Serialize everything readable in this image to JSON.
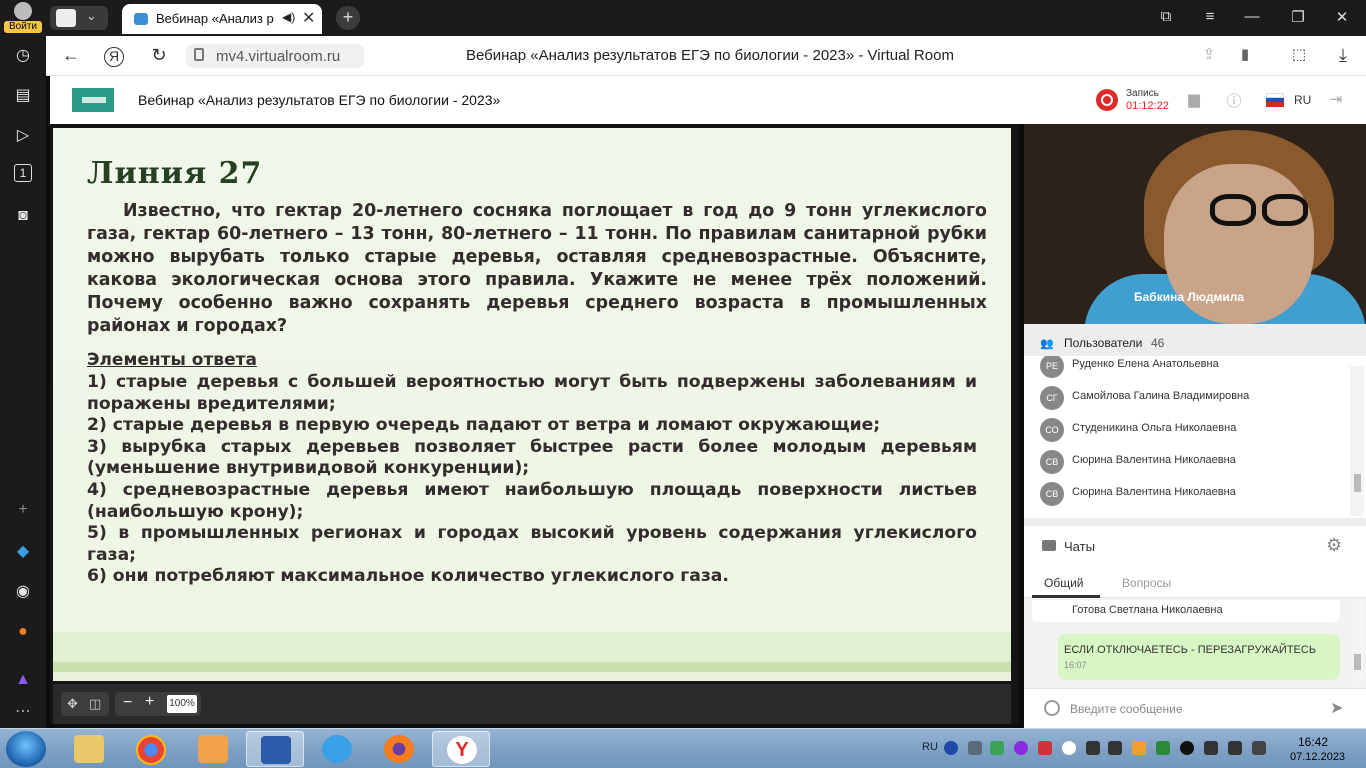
{
  "browser": {
    "login_label": "Войти",
    "tab_title": "Вебинар «Анализ ре",
    "url": "mv4.virtualroom.ru",
    "page_title": "Вебинар «Анализ результатов ЕГЭ по биологии - 2023» - Virtual Room"
  },
  "app": {
    "webinar_title": "Вебинар «Анализ результатов ЕГЭ по биологии - 2023»",
    "record_label": "Запись",
    "record_time": "01:12:22",
    "language": "RU"
  },
  "slide": {
    "heading": "Линия 27",
    "question": "Известно, что гектар 20-летнего сосняка поглощает в год до 9 тонн углекислого газа, гектар 60-летнего – 13 тонн, 80-летнего – 11 тонн. По правилам санитарной рубки можно вырубать только старые деревья, оставляя средневозрастные. Объясните, какова экологическая основа этого правила. Укажите не менее трёх положений. Почему особенно важно сохранять деревья среднего возраста в промышленных районах и городах?",
    "answer_heading": "Элементы ответа",
    "items": [
      "1) старые деревья с большей вероятностью могут быть подвержены заболеваниям и поражены вредителями;",
      "2) старые деревья в первую очередь падают от ветра и ломают окружающие;",
      "3) вырубка старых деревьев позволяет быстрее расти более молодым деревьям (уменьшение внутривидовой конкуренции);",
      "4) средневозрастные деревья имеют наибольшую площадь поверхности листьев (наибольшую крону);",
      "5) в промышленных регионах и городах высокий уровень содержания углекислого газа;",
      "6) они потребляют максимальное количество углекислого газа."
    ],
    "zoom": "100%"
  },
  "video": {
    "speaker": "Бабкина Людмила"
  },
  "users": {
    "title": "Пользователи",
    "count": "46",
    "list": [
      {
        "initials": "РЕ",
        "name": "Руденко Елена Анатольевна"
      },
      {
        "initials": "СГ",
        "name": "Самойлова Галина Владимировна"
      },
      {
        "initials": "СО",
        "name": "Студеникина Ольга Николаевна"
      },
      {
        "initials": "СВ",
        "name": "Сюрина Валентина Николаевна"
      },
      {
        "initials": "СВ",
        "name": "Сюрина Валентина Николаевна"
      }
    ]
  },
  "chats": {
    "title": "Чаты",
    "tab_common": "Общий",
    "tab_questions": "Вопросы",
    "prev_sender": "Готова Светлана Николаевна",
    "message_text": "ЕСЛИ ОТКЛЮЧАЕТЕСЬ - ПЕРЕЗАГРУЖАЙТЕСЬ",
    "message_time": "16:07",
    "input_placeholder": "Введите сообщение"
  },
  "taskbar": {
    "lang": "RU",
    "time": "16:42",
    "date": "07.12.2023"
  },
  "colors": {
    "slide_heading": "#264022",
    "slide_text": "#332c2c",
    "record_red": "#e02a2a",
    "chat_bubble": "#d8f5c4"
  }
}
